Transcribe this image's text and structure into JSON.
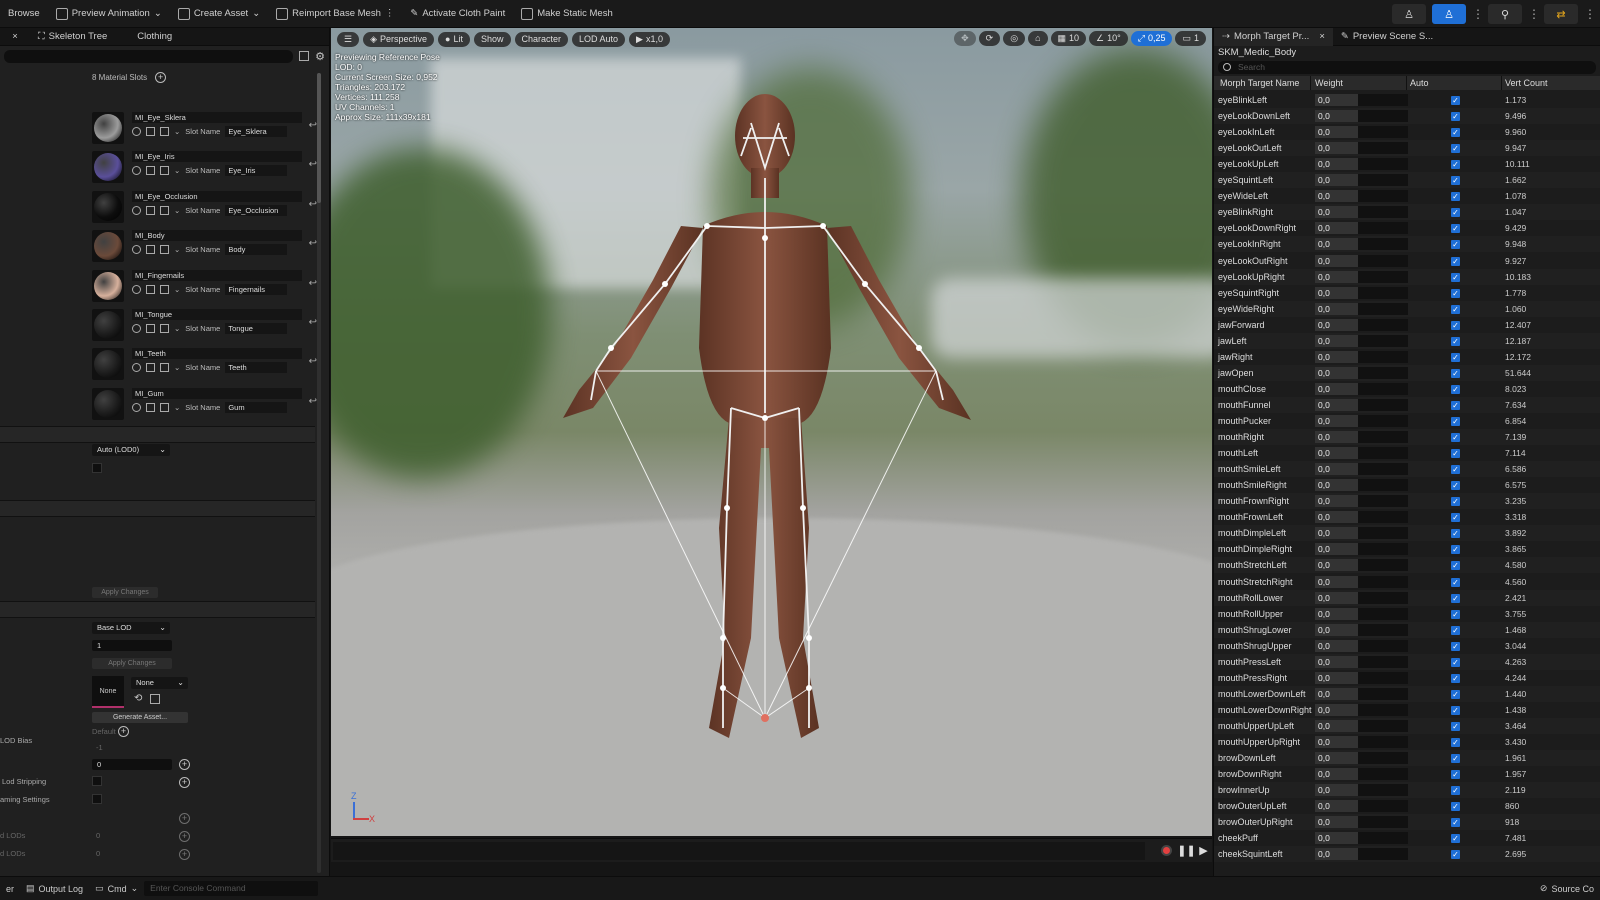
{
  "toolbar": {
    "browse": "Browse",
    "preview_animation": "Preview Animation",
    "create_asset": "Create Asset",
    "reimport_base_mesh": "Reimport Base Mesh",
    "activate_cloth_paint": "Activate Cloth Paint",
    "make_static_mesh": "Make Static Mesh"
  },
  "left_panel": {
    "tabs": [
      "Skeleton Tree",
      "Clothing"
    ],
    "material_slots_label": "8 Material Slots",
    "slot_name_label": "Slot Name",
    "slots": [
      {
        "material": "MI_Eye_Sklera",
        "slot": "Eye_Sklera",
        "color": "#9c9c9c"
      },
      {
        "material": "MI_Eye_Iris",
        "slot": "Eye_Iris",
        "color": "#5a4f9a"
      },
      {
        "material": "MI_Eye_Occlusion",
        "slot": "Eye_Occlusion",
        "color": "#0d0d0d"
      },
      {
        "material": "MI_Body",
        "slot": "Body",
        "color": "#6b4a3a"
      },
      {
        "material": "MI_Fingernails",
        "slot": "Fingernails",
        "color": "#d6b09c"
      },
      {
        "material": "MI_Tongue",
        "slot": "Tongue",
        "color": "#1b1b1b"
      },
      {
        "material": "MI_Teeth",
        "slot": "Teeth",
        "color": "#1b1b1b"
      },
      {
        "material": "MI_Gum",
        "slot": "Gum",
        "color": "#1b1b1b"
      }
    ],
    "lod_select": "Auto (LOD0)",
    "apply_changes_1": "Apply Changes",
    "base_lod": "Base LOD",
    "lod_value": "1",
    "apply_changes_2": "Apply Changes",
    "thumb_none": "None",
    "none_select": "None",
    "generate_asset": "Generate Asset...",
    "lod_bias_label": "LOD Bias",
    "default_label": "Default",
    "lod_bias_value": "-1",
    "field_zero": "0",
    "lod_stripping_label": "Lod Stripping",
    "streaming_settings_label": "aming Settings",
    "lods_label_1": "d LODs",
    "lods_value_1": "0",
    "lods_label_2": "d LODs",
    "lods_value_2": "0"
  },
  "viewport": {
    "perspective": "Perspective",
    "lit": "Lit",
    "show": "Show",
    "character": "Character",
    "lod_auto": "LOD Auto",
    "speed": "x1,0",
    "grid": "10",
    "angle": "10°",
    "scale": "0,25",
    "camera": "1",
    "info": [
      "Previewing Reference Pose",
      "LOD: 0",
      "Current Screen Size: 0,952",
      "Triangles: 203.172",
      "Vertices: 111.258",
      "UV Channels: 1",
      "Approx Size: 111x39x181"
    ],
    "axis_z": "Z",
    "axis_x": "X"
  },
  "right_panel": {
    "tabs": [
      "Morph Target Pr...",
      "Preview Scene S..."
    ],
    "mesh_name": "SKM_Medic_Body",
    "search_placeholder": "Search",
    "columns": [
      "Morph Target Name",
      "Weight",
      "Auto",
      "Vert Count"
    ],
    "rows": [
      {
        "name": "eyeBlinkLeft",
        "weight": "0,0",
        "verts": "1.173"
      },
      {
        "name": "eyeLookDownLeft",
        "weight": "0,0",
        "verts": "9.496"
      },
      {
        "name": "eyeLookInLeft",
        "weight": "0,0",
        "verts": "9.960"
      },
      {
        "name": "eyeLookOutLeft",
        "weight": "0,0",
        "verts": "9.947"
      },
      {
        "name": "eyeLookUpLeft",
        "weight": "0,0",
        "verts": "10.111"
      },
      {
        "name": "eyeSquintLeft",
        "weight": "0,0",
        "verts": "1.662"
      },
      {
        "name": "eyeWideLeft",
        "weight": "0,0",
        "verts": "1.078"
      },
      {
        "name": "eyeBlinkRight",
        "weight": "0,0",
        "verts": "1.047"
      },
      {
        "name": "eyeLookDownRight",
        "weight": "0,0",
        "verts": "9.429"
      },
      {
        "name": "eyeLookInRight",
        "weight": "0,0",
        "verts": "9.948"
      },
      {
        "name": "eyeLookOutRight",
        "weight": "0,0",
        "verts": "9.927"
      },
      {
        "name": "eyeLookUpRight",
        "weight": "0,0",
        "verts": "10.183"
      },
      {
        "name": "eyeSquintRight",
        "weight": "0,0",
        "verts": "1.778"
      },
      {
        "name": "eyeWideRight",
        "weight": "0,0",
        "verts": "1.060"
      },
      {
        "name": "jawForward",
        "weight": "0,0",
        "verts": "12.407"
      },
      {
        "name": "jawLeft",
        "weight": "0,0",
        "verts": "12.187"
      },
      {
        "name": "jawRight",
        "weight": "0,0",
        "verts": "12.172"
      },
      {
        "name": "jawOpen",
        "weight": "0,0",
        "verts": "51.644"
      },
      {
        "name": "mouthClose",
        "weight": "0,0",
        "verts": "8.023"
      },
      {
        "name": "mouthFunnel",
        "weight": "0,0",
        "verts": "7.634"
      },
      {
        "name": "mouthPucker",
        "weight": "0,0",
        "verts": "6.854"
      },
      {
        "name": "mouthRight",
        "weight": "0,0",
        "verts": "7.139"
      },
      {
        "name": "mouthLeft",
        "weight": "0,0",
        "verts": "7.114"
      },
      {
        "name": "mouthSmileLeft",
        "weight": "0,0",
        "verts": "6.586"
      },
      {
        "name": "mouthSmileRight",
        "weight": "0,0",
        "verts": "6.575"
      },
      {
        "name": "mouthFrownRight",
        "weight": "0,0",
        "verts": "3.235"
      },
      {
        "name": "mouthFrownLeft",
        "weight": "0,0",
        "verts": "3.318"
      },
      {
        "name": "mouthDimpleLeft",
        "weight": "0,0",
        "verts": "3.892"
      },
      {
        "name": "mouthDimpleRight",
        "weight": "0,0",
        "verts": "3.865"
      },
      {
        "name": "mouthStretchLeft",
        "weight": "0,0",
        "verts": "4.580"
      },
      {
        "name": "mouthStretchRight",
        "weight": "0,0",
        "verts": "4.560"
      },
      {
        "name": "mouthRollLower",
        "weight": "0,0",
        "verts": "2.421"
      },
      {
        "name": "mouthRollUpper",
        "weight": "0,0",
        "verts": "3.755"
      },
      {
        "name": "mouthShrugLower",
        "weight": "0,0",
        "verts": "1.468"
      },
      {
        "name": "mouthShrugUpper",
        "weight": "0,0",
        "verts": "3.044"
      },
      {
        "name": "mouthPressLeft",
        "weight": "0,0",
        "verts": "4.263"
      },
      {
        "name": "mouthPressRight",
        "weight": "0,0",
        "verts": "4.244"
      },
      {
        "name": "mouthLowerDownLeft",
        "weight": "0,0",
        "verts": "1.440"
      },
      {
        "name": "mouthLowerDownRight",
        "weight": "0,0",
        "verts": "1.438"
      },
      {
        "name": "mouthUpperUpLeft",
        "weight": "0,0",
        "verts": "3.464"
      },
      {
        "name": "mouthUpperUpRight",
        "weight": "0,0",
        "verts": "3.430"
      },
      {
        "name": "browDownLeft",
        "weight": "0,0",
        "verts": "1.961"
      },
      {
        "name": "browDownRight",
        "weight": "0,0",
        "verts": "1.957"
      },
      {
        "name": "browInnerUp",
        "weight": "0,0",
        "verts": "2.119"
      },
      {
        "name": "browOuterUpLeft",
        "weight": "0,0",
        "verts": "860"
      },
      {
        "name": "browOuterUpRight",
        "weight": "0,0",
        "verts": "918"
      },
      {
        "name": "cheekPuff",
        "weight": "0,0",
        "verts": "7.481"
      },
      {
        "name": "cheekSquintLeft",
        "weight": "0,0",
        "verts": "2.695"
      }
    ]
  },
  "statusbar": {
    "left_stub": "er",
    "output_log": "Output Log",
    "cmd": "Cmd",
    "console_placeholder": "Enter Console Command",
    "source_control": "Source Co"
  },
  "colors": {
    "accent": "#1f6fd6",
    "record": "#e24040",
    "skin": "#7a4a36"
  }
}
